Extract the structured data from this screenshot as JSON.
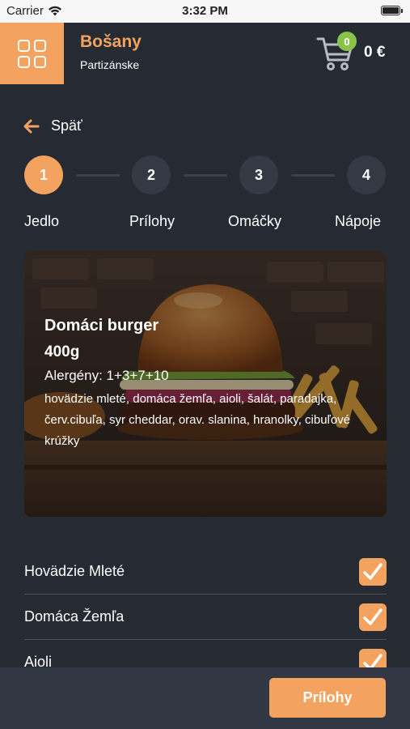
{
  "status_bar": {
    "carrier": "Carrier",
    "time": "3:32 PM"
  },
  "header": {
    "brand_name": "Bošany",
    "city": "Partizánske",
    "cart_count": "0",
    "cart_total": "0 €",
    "colors": {
      "accent": "#f3a35f",
      "badge": "#8bc34a",
      "background": "#262b33"
    }
  },
  "back": {
    "label": "Späť"
  },
  "steps": [
    {
      "number": "1",
      "label": "Jedlo",
      "active": true
    },
    {
      "number": "2",
      "label": "Prílohy",
      "active": false
    },
    {
      "number": "3",
      "label": "Omáčky",
      "active": false
    },
    {
      "number": "4",
      "label": "Nápoje",
      "active": false
    }
  ],
  "product": {
    "title": "Domáci burger",
    "weight": "400g",
    "allergens": "Alergény: 1+3+7+10",
    "description": "hovädzie mleté, domáca žemľa, aioli, šalát, paradajka, červ.cibuľa, syr cheddar, orav. slanina, hranolky, cibuľové krúžky"
  },
  "ingredients": [
    {
      "label": "Hovädzie Mleté",
      "checked": true
    },
    {
      "label": "Domáca Žemľa",
      "checked": true
    },
    {
      "label": "Aioli",
      "checked": true
    }
  ],
  "footer": {
    "next_label": "Prílohy"
  }
}
